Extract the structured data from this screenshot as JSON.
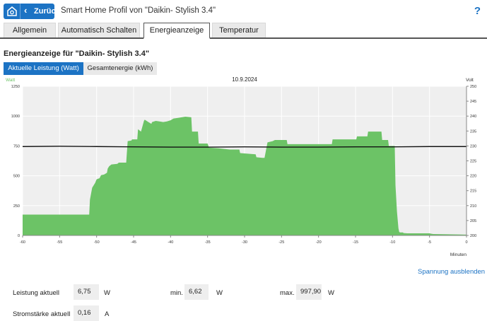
{
  "header": {
    "back_label": "Zurück",
    "title": "Smart Home Profil von \"Daikin- Stylish 3.4\"",
    "help": "?"
  },
  "tabs": [
    {
      "label": "Allgemein"
    },
    {
      "label": "Automatisch Schalten"
    },
    {
      "label": "Energieanzeige"
    },
    {
      "label": "Temperatur"
    }
  ],
  "active_tab": "Energieanzeige",
  "section_title": "Energieanzeige für \"Daikin- Stylish 3.4\"",
  "subtabs": [
    {
      "label": "Aktuelle Leistung (Watt)"
    },
    {
      "label": "Gesamtenergie (kWh)"
    }
  ],
  "active_subtab": "Aktuelle Leistung (Watt)",
  "chart_data": {
    "type": "area",
    "title": "10.9.2024",
    "ylabel": "Watt",
    "y2label": "Volt",
    "xlabel": "Minuten",
    "x_ticks": [
      -60,
      -55,
      -50,
      -45,
      -40,
      -35,
      -30,
      -25,
      -20,
      -15,
      -10,
      -5,
      0
    ],
    "x_ticklabels": [
      "-60",
      "-55",
      "-50",
      "-45",
      "-40",
      "-35",
      "-30",
      "-25",
      "-20",
      "-15",
      "-10",
      "-5",
      "0"
    ],
    "y_ticks": [
      0,
      250,
      500,
      750,
      1000,
      1250
    ],
    "y_ticklabels": [
      "0",
      "250",
      "500",
      "750",
      "1000",
      "1250"
    ],
    "y2_ticks": [
      200,
      205,
      210,
      215,
      220,
      225,
      230,
      235,
      240,
      245,
      250
    ],
    "y2_ticklabels": [
      "200",
      "205",
      "210",
      "215",
      "220",
      "225",
      "230",
      "235",
      "240",
      "245",
      "250"
    ],
    "xlim": [
      -60,
      0
    ],
    "ylim": [
      0,
      1250
    ],
    "y2lim": [
      200,
      250
    ],
    "grid": true,
    "colors": {
      "power": "#6cc366",
      "voltage": "#111111",
      "plot_bg": "#efefef",
      "watt_label": "#6cc366"
    },
    "series": [
      {
        "name": "Leistung",
        "unit": "Watt",
        "x": [
          -60,
          -51,
          -50.9,
          -50.6,
          -50.2,
          -50,
          -49.6,
          -49.4,
          -49,
          -48.6,
          -48.5,
          -48.3,
          -48,
          -47.2,
          -47,
          -46.5,
          -46,
          -45.8,
          -45.3,
          -45.2,
          -44.5,
          -44.4,
          -44,
          -43.6,
          -43.5,
          -43,
          -42.6,
          -42.5,
          -42,
          -41.5,
          -41,
          -40.5,
          -40,
          -39.6,
          -39,
          -38.5,
          -38,
          -37.2,
          -37.1,
          -36.3,
          -36.2,
          -35,
          -34.8,
          -33.5,
          -32,
          -30.7,
          -30.6,
          -28.5,
          -28.4,
          -27.6,
          -27.3,
          -26.9,
          -26.2,
          -25.9,
          -25.2,
          -24.3,
          -24.2,
          -18.2,
          -18.1,
          -14.9,
          -14.8,
          -13.4,
          -13.3,
          -11.5,
          -11.4,
          -10.6,
          -10.5,
          -9.7,
          -9.6,
          -9.4,
          -9.2,
          -9.1,
          -9,
          -8.6,
          -8.5,
          -8,
          -5,
          -4.8,
          -4.5,
          -3,
          -1,
          0
        ],
        "y": [
          175,
          175,
          300,
          400,
          440,
          470,
          480,
          505,
          510,
          525,
          560,
          580,
          595,
          600,
          610,
          610,
          610,
          790,
          795,
          805,
          805,
          890,
          870,
          960,
          970,
          950,
          935,
          950,
          960,
          955,
          950,
          955,
          965,
          980,
          985,
          990,
          995,
          990,
          870,
          870,
          770,
          770,
          735,
          730,
          720,
          720,
          690,
          680,
          655,
          650,
          650,
          780,
          790,
          800,
          800,
          800,
          765,
          765,
          805,
          805,
          830,
          830,
          870,
          870,
          800,
          800,
          750,
          750,
          420,
          200,
          60,
          30,
          25,
          25,
          20,
          18,
          18,
          15,
          12,
          10,
          8,
          7
        ]
      },
      {
        "name": "Spannung",
        "unit": "Volt",
        "x": [
          -60,
          -55,
          -50,
          -45,
          -40,
          -35,
          -30,
          -25,
          -20,
          -15,
          -10,
          -5,
          0
        ],
        "y": [
          229.8,
          229.9,
          229.8,
          229.7,
          229.6,
          229.6,
          229.7,
          229.6,
          229.6,
          229.7,
          229.7,
          229.8,
          229.8
        ]
      }
    ]
  },
  "spannung_toggle": "Spannung ausblenden",
  "stats": {
    "leistung_label": "Leistung aktuell",
    "leistung_value": "6,75",
    "leistung_unit": "W",
    "min_label": "min.",
    "min_value": "6,62",
    "min_unit": "W",
    "max_label": "max.",
    "max_value": "997,90",
    "max_unit": "W",
    "strom_label": "Stromstärke aktuell",
    "strom_value": "0,16",
    "strom_unit": "A"
  }
}
